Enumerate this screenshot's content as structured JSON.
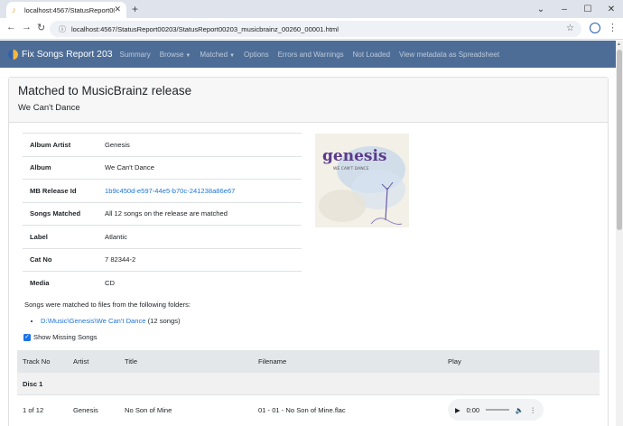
{
  "browser": {
    "tab_title": "localhost:4567/StatusReport0020",
    "url": "localhost:4567/StatusReport00203/StatusReport00203_musicbrainz_00260_00001.html"
  },
  "navbar": {
    "brand": "Fix Songs Report 203",
    "items": [
      {
        "label": "Summary"
      },
      {
        "label": "Browse",
        "dropdown": true
      },
      {
        "label": "Matched",
        "dropdown": true
      },
      {
        "label": "Options"
      },
      {
        "label": "Errors and Warnings"
      },
      {
        "label": "Not Loaded"
      },
      {
        "label": "View metadata as Spreadsheet"
      }
    ]
  },
  "header": {
    "title": "Matched to MusicBrainz release",
    "subtitle": "We Can't Dance"
  },
  "info": {
    "album_artist_k": "Album Artist",
    "album_artist_v": "Genesis",
    "album_k": "Album",
    "album_v": "We Can't Dance",
    "mb_k": "MB Release Id",
    "mb_v": "1b9c450d-e597-44e5-b70c-241238a86e67",
    "matched_k": "Songs Matched",
    "matched_v": "All 12 songs on the release are matched",
    "label_k": "Label",
    "label_v": "Atlantic",
    "cat_k": "Cat No",
    "cat_v": "7 82344-2",
    "media_k": "Media",
    "media_v": "CD"
  },
  "album_art": {
    "logo_text": "genesis",
    "caption": "WE CAN'T DANCE"
  },
  "folders": {
    "intro": "Songs were matched to files from the following folders:",
    "path": "D:\\Music\\Genesis\\We Can't Dance",
    "count": "(12 songs)"
  },
  "show_missing": {
    "label": "Show Missing Songs",
    "checked": true
  },
  "songs": {
    "headers": {
      "track": "Track No",
      "artist": "Artist",
      "title": "Title",
      "filename": "Filename",
      "play": "Play"
    },
    "disc": "Disc 1",
    "row1": {
      "track": "1 of 12",
      "artist": "Genesis",
      "title": "No Son of Mine",
      "filename": "01 - 01 - No Son of Mine.flac",
      "time": "0:00"
    }
  }
}
